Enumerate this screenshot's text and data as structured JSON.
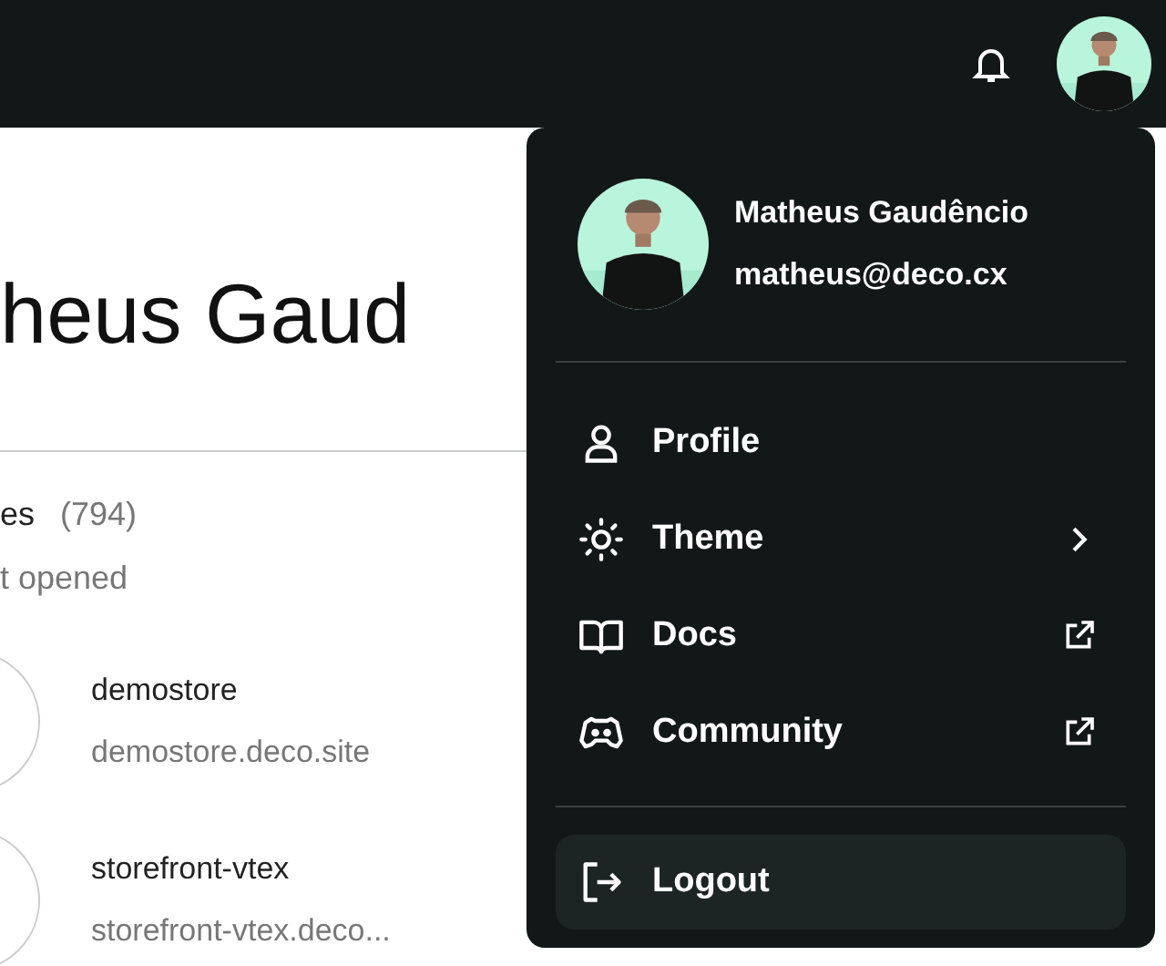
{
  "page": {
    "heading": "heus Gaud",
    "sites_label": "es",
    "sites_count": "(794)",
    "sort_label": "t opened",
    "sites": [
      {
        "name": "demostore",
        "domain": "demostore.deco.site"
      },
      {
        "name": "storefront-vtex",
        "domain": "storefront-vtex.deco..."
      }
    ]
  },
  "menu": {
    "user": {
      "name": "Matheus Gaudêncio",
      "email": "matheus@deco.cx"
    },
    "items": [
      {
        "label": "Profile",
        "kind": "link"
      },
      {
        "label": "Theme",
        "kind": "submenu"
      },
      {
        "label": "Docs",
        "kind": "external"
      },
      {
        "label": "Community",
        "kind": "external"
      }
    ],
    "logout": {
      "label": "Logout",
      "hovered": true
    }
  }
}
